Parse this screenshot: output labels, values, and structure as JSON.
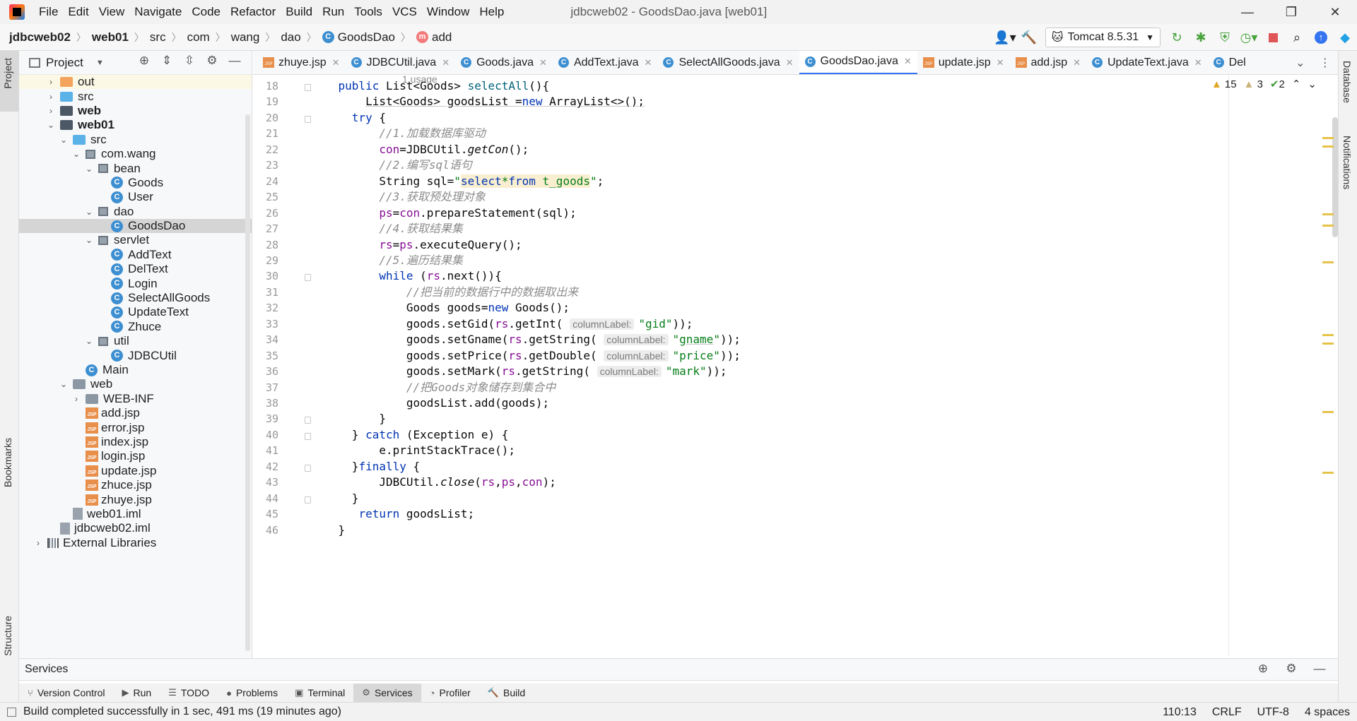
{
  "window": {
    "title": "jdbcweb02 - GoodsDao.java [web01]",
    "menu": [
      "File",
      "Edit",
      "View",
      "Navigate",
      "Code",
      "Refactor",
      "Build",
      "Run",
      "Tools",
      "VCS",
      "Window",
      "Help"
    ]
  },
  "breadcrumb": [
    "jdbcweb02",
    "web01",
    "src",
    "com",
    "wang",
    "dao",
    "GoodsDao",
    "add"
  ],
  "toolbar": {
    "run_config": "Tomcat 8.5.31"
  },
  "left_stripe": {
    "project": "Project",
    "bookmarks": "Bookmarks",
    "structure": "Structure"
  },
  "right_stripe": {
    "database": "Database",
    "notifications": "Notifications"
  },
  "project_panel": {
    "title": "Project",
    "tree": [
      {
        "label": "out",
        "indent": 0,
        "arrow": "›",
        "icon": "folder-orange",
        "bold": false
      },
      {
        "label": "src",
        "indent": 0,
        "arrow": "›",
        "icon": "folder-blue",
        "bold": false
      },
      {
        "label": "web",
        "indent": 0,
        "arrow": "›",
        "icon": "folder-dark",
        "bold": true
      },
      {
        "label": "web01",
        "indent": 0,
        "arrow": "⌄",
        "icon": "folder-dark",
        "bold": true
      },
      {
        "label": "src",
        "indent": 1,
        "arrow": "⌄",
        "icon": "folder-blue",
        "bold": false
      },
      {
        "label": "com.wang",
        "indent": 2,
        "arrow": "⌄",
        "icon": "package",
        "bold": false
      },
      {
        "label": "bean",
        "indent": 3,
        "arrow": "⌄",
        "icon": "package",
        "bold": false
      },
      {
        "label": "Goods",
        "indent": 4,
        "arrow": "",
        "icon": "class",
        "bold": false
      },
      {
        "label": "User",
        "indent": 4,
        "arrow": "",
        "icon": "class",
        "bold": false
      },
      {
        "label": "dao",
        "indent": 3,
        "arrow": "⌄",
        "icon": "package",
        "bold": false
      },
      {
        "label": "GoodsDao",
        "indent": 4,
        "arrow": "",
        "icon": "class",
        "bold": false,
        "selected": true
      },
      {
        "label": "servlet",
        "indent": 3,
        "arrow": "⌄",
        "icon": "package",
        "bold": false
      },
      {
        "label": "AddText",
        "indent": 4,
        "arrow": "",
        "icon": "class",
        "bold": false
      },
      {
        "label": "DelText",
        "indent": 4,
        "arrow": "",
        "icon": "class",
        "bold": false
      },
      {
        "label": "Login",
        "indent": 4,
        "arrow": "",
        "icon": "class",
        "bold": false
      },
      {
        "label": "SelectAllGoods",
        "indent": 4,
        "arrow": "",
        "icon": "class",
        "bold": false
      },
      {
        "label": "UpdateText",
        "indent": 4,
        "arrow": "",
        "icon": "class",
        "bold": false
      },
      {
        "label": "Zhuce",
        "indent": 4,
        "arrow": "",
        "icon": "class",
        "bold": false
      },
      {
        "label": "util",
        "indent": 3,
        "arrow": "⌄",
        "icon": "package",
        "bold": false
      },
      {
        "label": "JDBCUtil",
        "indent": 4,
        "arrow": "",
        "icon": "class",
        "bold": false
      },
      {
        "label": "Main",
        "indent": 2,
        "arrow": "",
        "icon": "class",
        "bold": false
      },
      {
        "label": "web",
        "indent": 1,
        "arrow": "⌄",
        "icon": "folder-gray",
        "bold": false
      },
      {
        "label": "WEB-INF",
        "indent": 2,
        "arrow": "›",
        "icon": "folder-gray",
        "bold": false
      },
      {
        "label": "add.jsp",
        "indent": 2,
        "arrow": "",
        "icon": "jsp",
        "bold": false
      },
      {
        "label": "error.jsp",
        "indent": 2,
        "arrow": "",
        "icon": "jsp",
        "bold": false
      },
      {
        "label": "index.jsp",
        "indent": 2,
        "arrow": "",
        "icon": "jsp",
        "bold": false
      },
      {
        "label": "login.jsp",
        "indent": 2,
        "arrow": "",
        "icon": "jsp",
        "bold": false
      },
      {
        "label": "update.jsp",
        "indent": 2,
        "arrow": "",
        "icon": "jsp",
        "bold": false
      },
      {
        "label": "zhuce.jsp",
        "indent": 2,
        "arrow": "",
        "icon": "jsp",
        "bold": false
      },
      {
        "label": "zhuye.jsp",
        "indent": 2,
        "arrow": "",
        "icon": "jsp",
        "bold": false
      },
      {
        "label": "web01.iml",
        "indent": 1,
        "arrow": "",
        "icon": "file",
        "bold": false
      },
      {
        "label": "jdbcweb02.iml",
        "indent": 0,
        "arrow": "",
        "icon": "file",
        "bold": false
      },
      {
        "label": "External Libraries",
        "indent": -1,
        "arrow": "›",
        "icon": "library",
        "bold": false
      }
    ]
  },
  "editor_tabs": [
    {
      "label": "zhuye.jsp",
      "icon": "jsp"
    },
    {
      "label": "JDBCUtil.java",
      "icon": "class"
    },
    {
      "label": "Goods.java",
      "icon": "class"
    },
    {
      "label": "AddText.java",
      "icon": "class"
    },
    {
      "label": "SelectAllGoods.java",
      "icon": "class"
    },
    {
      "label": "GoodsDao.java",
      "icon": "class",
      "active": true
    },
    {
      "label": "update.jsp",
      "icon": "jsp"
    },
    {
      "label": "add.jsp",
      "icon": "jsp"
    },
    {
      "label": "UpdateText.java",
      "icon": "class"
    },
    {
      "label": "Del",
      "icon": "class",
      "truncated": true
    }
  ],
  "editor": {
    "usage_hint": "1 usage",
    "inspections": {
      "warnings": "15",
      "weak_warnings": "3",
      "ok": "2"
    },
    "lines": [
      {
        "n": "18",
        "html": "    <span class=\"kw\">public</span> List&lt;Goods&gt; <span class=\"fn\">selectAll</span>(){"
      },
      {
        "n": "19",
        "html": "        <span class=\"underline\">List&lt;Goods&gt; goodsList =<span class=\"kw\">new</span> ArrayList&lt;&gt;();</span>"
      },
      {
        "n": "20",
        "html": "      <span class=\"kw\">try</span> {"
      },
      {
        "n": "21",
        "html": "          <span class=\"cmt\">//1.加载数据库驱动</span>"
      },
      {
        "n": "22",
        "html": "          <span class=\"var\">con</span>=JDBCUtil.<span class=\"it\">getCon</span>();"
      },
      {
        "n": "23",
        "html": "          <span class=\"cmt\">//2.编写sql语句</span>"
      },
      {
        "n": "24",
        "html": "          String sql=<span class=\"str\">\"<span class=\"sql-bg\"><span class=\"kw\">select</span>*<span class=\"kw\">from</span> t_goods</span>\"</span>;"
      },
      {
        "n": "25",
        "html": "          <span class=\"cmt\">//3.获取预处理对象</span>"
      },
      {
        "n": "26",
        "html": "          <span class=\"var\">ps</span>=<span class=\"var\">con</span>.prepareStatement(sql);"
      },
      {
        "n": "27",
        "html": "          <span class=\"cmt\">//4.获取结果集</span>"
      },
      {
        "n": "28",
        "html": "          <span class=\"var\">rs</span>=<span class=\"var\">ps</span>.executeQuery();"
      },
      {
        "n": "29",
        "html": "          <span class=\"cmt\">//5.遍历结果集</span>"
      },
      {
        "n": "30",
        "html": "          <span class=\"kw\">while</span> (<span class=\"var\">rs</span>.next()){"
      },
      {
        "n": "31",
        "html": "              <span class=\"cmt\">//把当前的数据行中的数据取出来</span>"
      },
      {
        "n": "32",
        "html": "              Goods goods=<span class=\"kw\">new</span> Goods();"
      },
      {
        "n": "33",
        "html": "              goods.setGid(<span class=\"var\">rs</span>.getInt( <span class=\"hint\">columnLabel:</span><span class=\"str\">\"gid\"</span>));"
      },
      {
        "n": "34",
        "html": "              goods.setGname(<span class=\"var\">rs</span>.getString( <span class=\"hint\">columnLabel:</span><span class=\"str\">\"<span class=\"underline\">gname</span>\"</span>));"
      },
      {
        "n": "35",
        "html": "              goods.setPrice(<span class=\"var\">rs</span>.getDouble( <span class=\"hint\">columnLabel:</span><span class=\"str\">\"price\"</span>));"
      },
      {
        "n": "36",
        "html": "              goods.setMark(<span class=\"var\">rs</span>.getString( <span class=\"hint\">columnLabel:</span><span class=\"str\">\"mark\"</span>));"
      },
      {
        "n": "37",
        "html": "              <span class=\"cmt\">//把Goods对象储存到集合中</span>"
      },
      {
        "n": "38",
        "html": "              goodsList.add(goods);"
      },
      {
        "n": "39",
        "html": "          }"
      },
      {
        "n": "40",
        "html": "      } <span class=\"kw\">catch</span> (Exception e) {"
      },
      {
        "n": "41",
        "html": "          e.printStackTrace();"
      },
      {
        "n": "42",
        "html": "      }<span class=\"kw\">finally</span> {"
      },
      {
        "n": "43",
        "html": "          JDBCUtil.<span class=\"it\">close</span>(<span class=\"var\">rs</span>,<span class=\"var\">ps</span>,<span class=\"var\">con</span>);"
      },
      {
        "n": "44",
        "html": "      }"
      },
      {
        "n": "45",
        "html": "       <span class=\"kw\">return</span> goodsList;"
      },
      {
        "n": "46",
        "html": "    }"
      }
    ]
  },
  "services": {
    "title": "Services"
  },
  "tool_windows": [
    {
      "label": "Version Control",
      "icon": "⑂"
    },
    {
      "label": "Run",
      "icon": "▶"
    },
    {
      "label": "TODO",
      "icon": "☰"
    },
    {
      "label": "Problems",
      "icon": "●"
    },
    {
      "label": "Terminal",
      "icon": "▣"
    },
    {
      "label": "Services",
      "icon": "⚙",
      "active": true
    },
    {
      "label": "Profiler",
      "icon": "◔"
    },
    {
      "label": "Build",
      "icon": "🔨"
    }
  ],
  "status": {
    "message": "Build completed successfully in 1 sec, 491 ms (19 minutes ago)",
    "position": "110:13",
    "line_sep": "CRLF",
    "encoding": "UTF-8",
    "indent": "4 spaces"
  }
}
